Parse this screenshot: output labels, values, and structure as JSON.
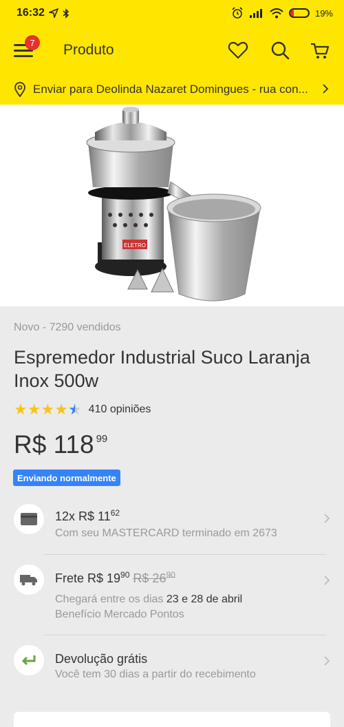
{
  "status_bar": {
    "time": "16:32",
    "battery_text": "19%",
    "battery_level": 0.19
  },
  "header": {
    "title": "Produto",
    "notification_count": "7",
    "brand_color": "#ffe600"
  },
  "address": {
    "text": "Enviar para Deolinda Nazaret Domingues - rua con..."
  },
  "product": {
    "condition": "Novo - 7290 vendidos",
    "title": "Espremedor Industrial Suco Laranja Inox 500w",
    "rating": 4.5,
    "reviews": "410 opiniões",
    "price_integer": "R$ 118",
    "price_cents": "99",
    "shipping_tag": "Enviando normalmente",
    "image_brand_label": "ELETRO"
  },
  "installments": {
    "prefix": "12x R$ 11",
    "cents": "62",
    "detail": "Com seu MASTERCARD terminado em 2673"
  },
  "shipping": {
    "label": "Frete R$ 19",
    "cents": "90",
    "old_price": "R$ 26",
    "old_cents": "90",
    "arrival_prefix": "Chegará entre os dias ",
    "arrival_dates": "23 e 28 de abril",
    "benefit": "Benefício Mercado Pontos"
  },
  "returns": {
    "title": "Devolução grátis",
    "detail": "Você tem 30 dias a partir do recebimento"
  },
  "colors": {
    "accent_blue": "#3483fa",
    "green": "#6aa43a",
    "badge_red": "#e8302a"
  }
}
